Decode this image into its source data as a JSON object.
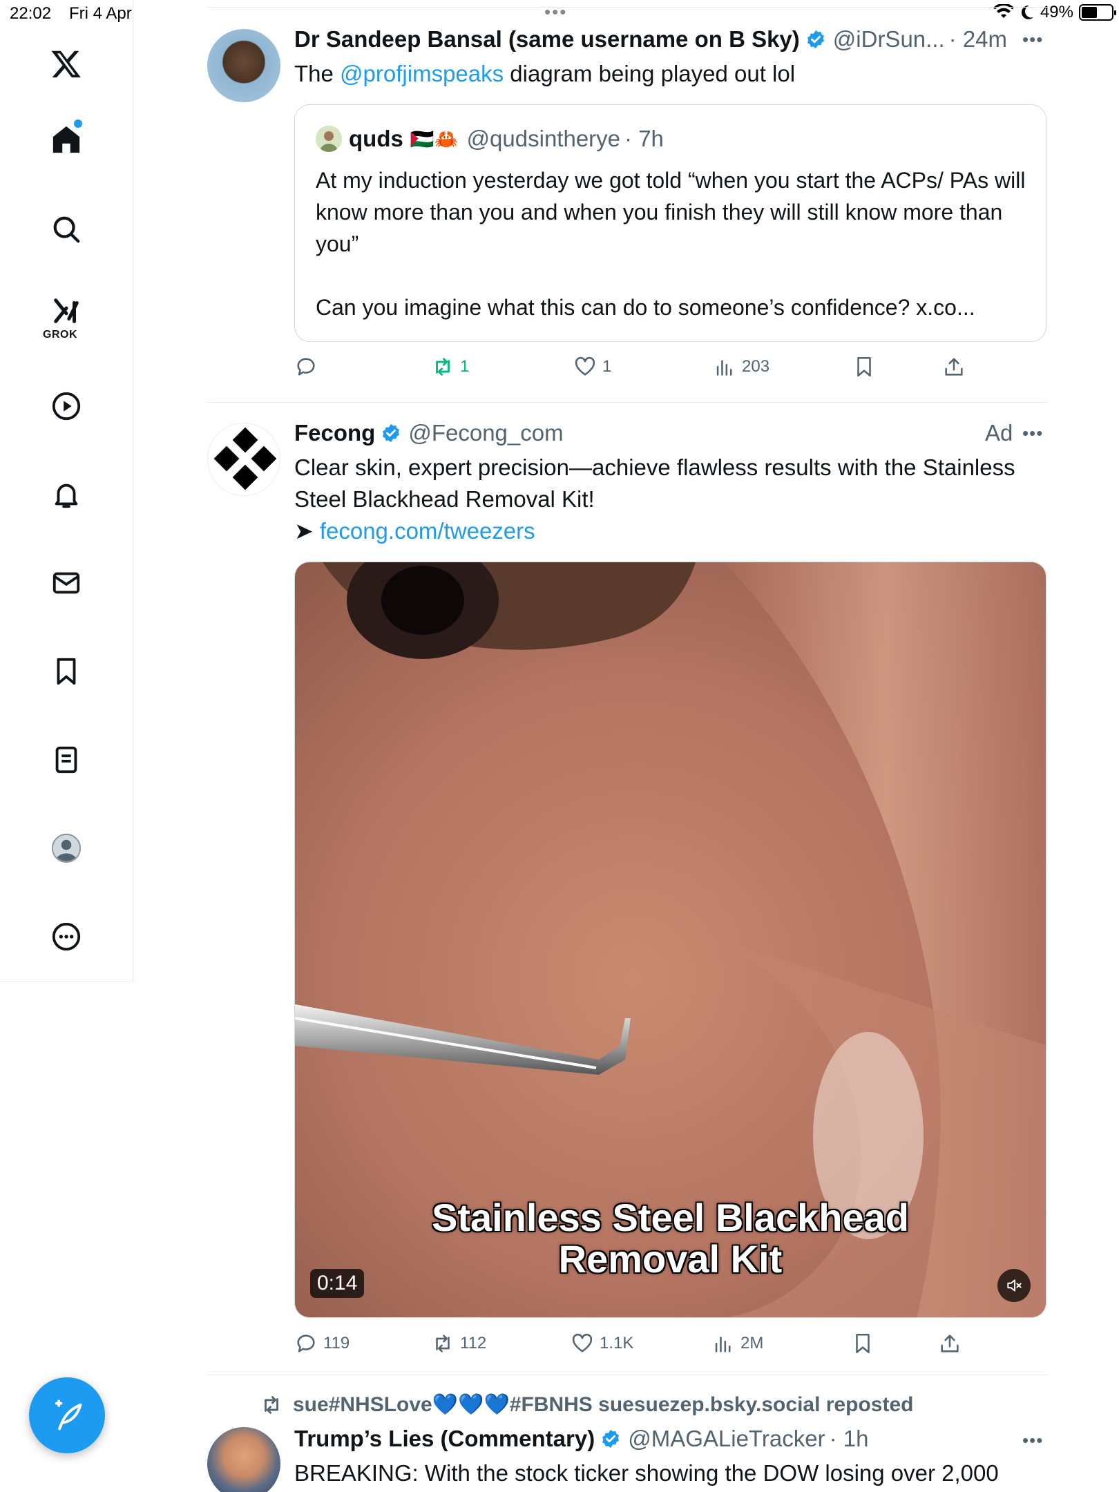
{
  "status_bar": {
    "time": "22:02",
    "date": "Fri 4 Apr",
    "battery": "49%",
    "battery_level": 0.49
  },
  "sidebar": {
    "items": [
      "x-logo",
      "home",
      "search",
      "grok",
      "videos",
      "notifications",
      "messages",
      "bookmarks",
      "lists",
      "profile",
      "more"
    ],
    "grok_label": "GROK",
    "compose_label": "+"
  },
  "tweet1": {
    "author_name": "Dr Sandeep Bansal (same username on B Sky)",
    "author_handle": "@iDrSun...",
    "time": "· 24m",
    "text_prefix": "The ",
    "mention": "@profjimspeaks",
    "text_suffix": " diagram being played out lol",
    "quote": {
      "name": "quds",
      "emoji": "🇵🇸🦀",
      "handle": "@qudsintherye",
      "time": "· 7h",
      "text": "At my induction yesterday we got told “when you start the ACPs/ PAs will know more than you and when you finish they will still know more than you”\n\nCan you imagine what this can do to someone’s confidence? x.co..."
    },
    "actions": {
      "replies": "",
      "reposts": "1",
      "likes": "1",
      "views": "203"
    }
  },
  "tweet2": {
    "author_name": "Fecong",
    "author_handle": "@Fecong_com",
    "ad_label": "Ad",
    "text": "Clear skin, expert precision—achieve flawless results with the Stainless Steel Blackhead Removal Kit!",
    "arrow": "➤ ",
    "link": "fecong.com/tweezers",
    "video": {
      "caption_line1": "Stainless Steel Blackhead",
      "caption_line2": "Removal Kit",
      "duration": "0:14"
    },
    "actions": {
      "replies": "119",
      "reposts": "112",
      "likes": "1.1K",
      "views": "2M"
    }
  },
  "tweet3": {
    "repost_by": "sue#NHSLove💙💙💙#FBNHS suesuezep.bsky.social reposted",
    "author_name": "Trump’s Lies (Commentary)",
    "author_handle": "@MAGALieTracker",
    "time": "· 1h",
    "text": "BREAKING: With the stock ticker showing the DOW losing over 2,000"
  },
  "colors": {
    "accent": "#1d9bf0",
    "text": "#0f1419",
    "secondary": "#536471",
    "repost_green": "#00ba7c",
    "border": "#cfd9de"
  }
}
